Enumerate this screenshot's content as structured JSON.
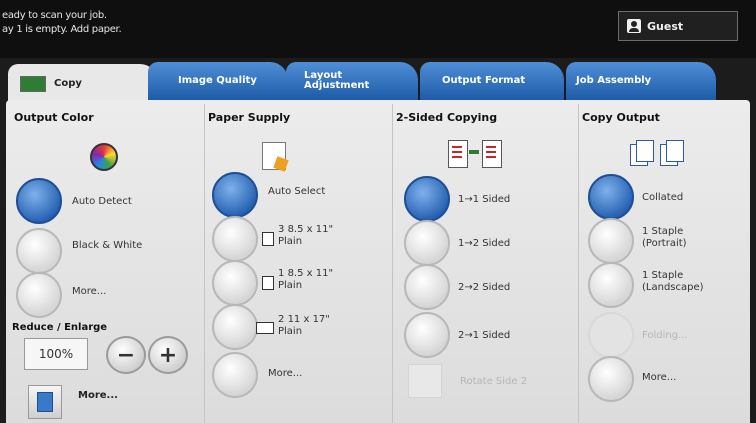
{
  "status": {
    "line1": "eady to scan your job.",
    "line2": "ay 1 is empty.  Add paper."
  },
  "user": {
    "label": "Guest",
    "icon": "user-icon"
  },
  "tabs": [
    {
      "label": "Copy"
    },
    {
      "label": "Image Quality"
    },
    {
      "label": "Layout Adjustment"
    },
    {
      "label": "Output Format"
    },
    {
      "label": "Job Assembly"
    }
  ],
  "output_color": {
    "title": "Output Color",
    "options": [
      "Auto Detect",
      "Black & White",
      "More..."
    ],
    "selected": "Auto Detect"
  },
  "reduce_enlarge": {
    "title": "Reduce / Enlarge",
    "value": "100%",
    "minus": "−",
    "plus": "+",
    "more": "More..."
  },
  "paper_supply": {
    "title": "Paper Supply",
    "auto": "Auto Select",
    "trays": [
      {
        "number": "3",
        "size": "8.5 x 11\"",
        "type": "Plain"
      },
      {
        "number": "1",
        "size": "8.5 x 11\"",
        "type": "Plain"
      },
      {
        "number": "2",
        "size": "11 x 17\"",
        "type": "Plain"
      }
    ],
    "more": "More..."
  },
  "two_sided": {
    "title": "2-Sided Copying",
    "options": [
      "1→1 Sided",
      "1→2 Sided",
      "2→2 Sided",
      "2→1 Sided"
    ],
    "rotate": "Rotate Side 2",
    "selected": "1→1 Sided"
  },
  "copy_output": {
    "title": "Copy Output",
    "collated": "Collated",
    "staple_portrait_1": "1 Staple",
    "staple_portrait_2": "(Portrait)",
    "staple_landscape_1": "1 Staple",
    "staple_landscape_2": "(Landscape)",
    "folding": "Folding...",
    "more": "More..."
  },
  "colors": {
    "accent": "#245fb0",
    "tab": "#2a6cc0",
    "panel": "#e6e6e6"
  }
}
